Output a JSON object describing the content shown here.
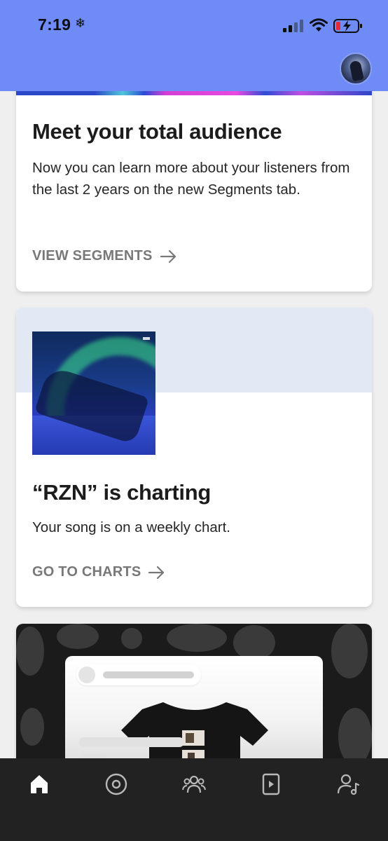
{
  "status_bar": {
    "time": "7:19",
    "snow_glyph": "❄",
    "background": "#6f8cf6"
  },
  "cards": {
    "audience": {
      "title": "Meet your total audience",
      "body": "Now you can learn more about your listeners from the last 2 years on the new Segments tab.",
      "cta": "VIEW SEGMENTS"
    },
    "charting": {
      "title": "“RZN” is charting",
      "body": "Your song is on a weekly chart.",
      "cta": "GO TO CHARTS"
    },
    "merch": {
      "background": "#1b1b1b"
    }
  },
  "tab_bar": {
    "items": [
      {
        "icon": "home-icon",
        "active": true
      },
      {
        "icon": "music-icon",
        "active": false
      },
      {
        "icon": "audience-icon",
        "active": false
      },
      {
        "icon": "video-icon",
        "active": false
      },
      {
        "icon": "team-icon",
        "active": false
      }
    ]
  }
}
